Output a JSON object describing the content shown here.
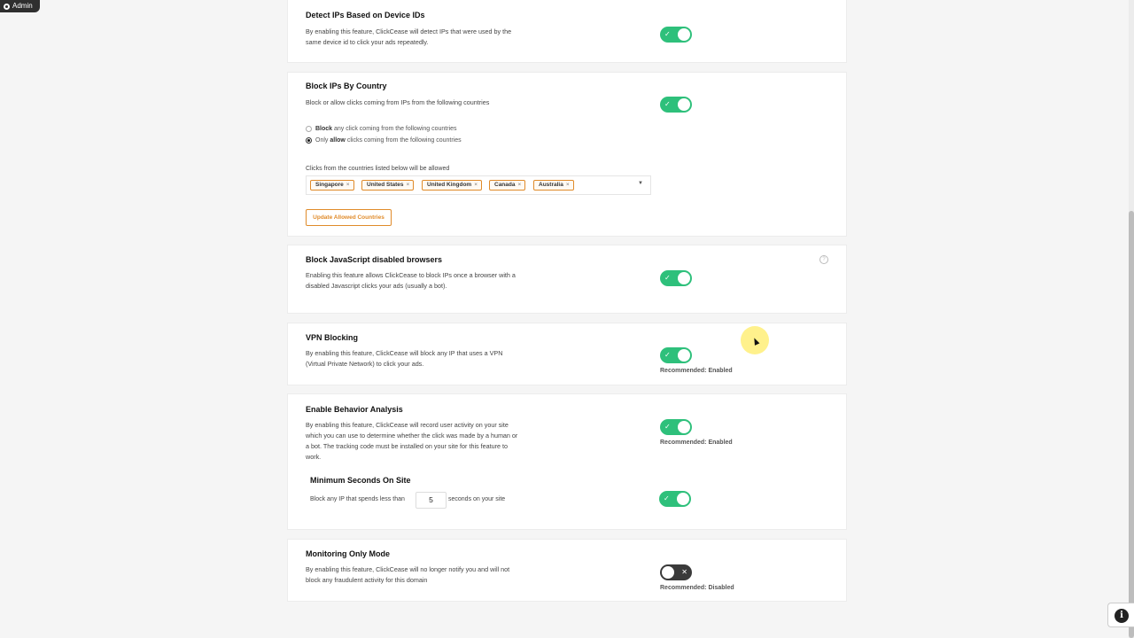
{
  "admin_badge": {
    "label": "Admin"
  },
  "cards": {
    "device_ids": {
      "title": "Detect IPs Based on Device IDs",
      "description": "By enabling this feature, ClickCease will detect IPs that were used by the same device id to click your ads repeatedly.",
      "enabled": true
    },
    "block_country": {
      "title": "Block IPs By Country",
      "description": "Block or allow clicks coming from IPs from the following countries",
      "enabled": true,
      "option_block_bold": "Block",
      "option_block_rest": "any click coming from the following countries",
      "option_allow_prefix": "Only",
      "option_allow_bold": "allow",
      "option_allow_rest": "clicks coming from the following countries",
      "selected_option": "allow",
      "list_label": "Clicks from the countries listed below will be allowed",
      "countries": [
        "Singapore",
        "United States",
        "United Kingdom",
        "Canada",
        "Australia"
      ],
      "chip_remove": "×",
      "dropdown_arrow": "▼",
      "update_button": "Update Allowed Countries"
    },
    "js_disabled": {
      "title": "Block JavaScript disabled browsers",
      "description": "Enabling this feature allows ClickCease to block IPs once a browser with a disabled Javascript clicks your ads (usually a bot).",
      "help": "?",
      "enabled": true
    },
    "vpn": {
      "title": "VPN Blocking",
      "description": "By enabling this feature, ClickCease will block any IP that uses a VPN (Virtual Private Network) to click your ads.",
      "enabled": true,
      "recommendation": "Recommended: Enabled"
    },
    "behavior": {
      "title": "Enable Behavior Analysis",
      "description": "By enabling this feature, ClickCease will record user activity on your site which you can use to determine whether the click was made by a human or a bot. The tracking code must be installed on your site for this feature to work.",
      "enabled": true,
      "recommendation": "Recommended: Enabled",
      "min_seconds_title": "Minimum Seconds On Site",
      "min_seconds_prefix": "Block any IP that spends less than",
      "min_seconds_value": "5",
      "min_seconds_suffix": "seconds on your site",
      "min_seconds_enabled": true
    },
    "monitoring": {
      "title": "Monitoring Only Mode",
      "description": "By enabling this feature, ClickCease will no longer notify you and will not block any fraudulent activity for this domain",
      "enabled": false,
      "recommendation": "Recommended: Disabled"
    }
  },
  "toggle_on_mark": "✓",
  "toggle_off_mark": "✕",
  "info_button": {
    "glyph": "i"
  },
  "colors": {
    "toggle_on": "#2ec07b",
    "toggle_off": "#3a3a3a",
    "accent": "#e08b2a"
  }
}
